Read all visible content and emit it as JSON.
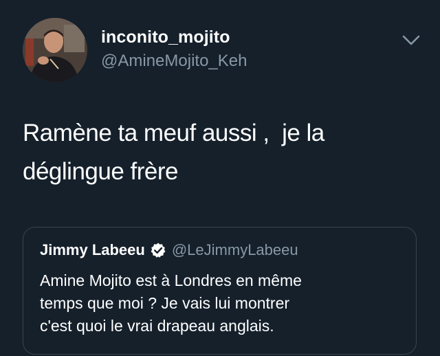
{
  "tweet": {
    "author": {
      "display_name": "inconito_mojito",
      "handle": "@AmineMojito_Keh",
      "avatar_icon": "user-photo"
    },
    "menu_icon": "chevron-down-icon",
    "text_lines": [
      "Ramène ta meuf aussi ,  je la",
      "déglingue frère"
    ]
  },
  "quoted_tweet": {
    "author": {
      "display_name": "Jimmy Labeeu",
      "verified": true,
      "handle": "@LeJimmyLabeeu"
    },
    "text_lines": [
      "Amine Mojito est à Londres en même",
      "temps que moi ? Je vais lui montrer",
      "c'est quoi le vrai drapeau anglais."
    ]
  },
  "colors": {
    "background": "#15202b",
    "text_primary": "#ffffff",
    "text_secondary": "#8899a6",
    "border": "#38444d"
  }
}
